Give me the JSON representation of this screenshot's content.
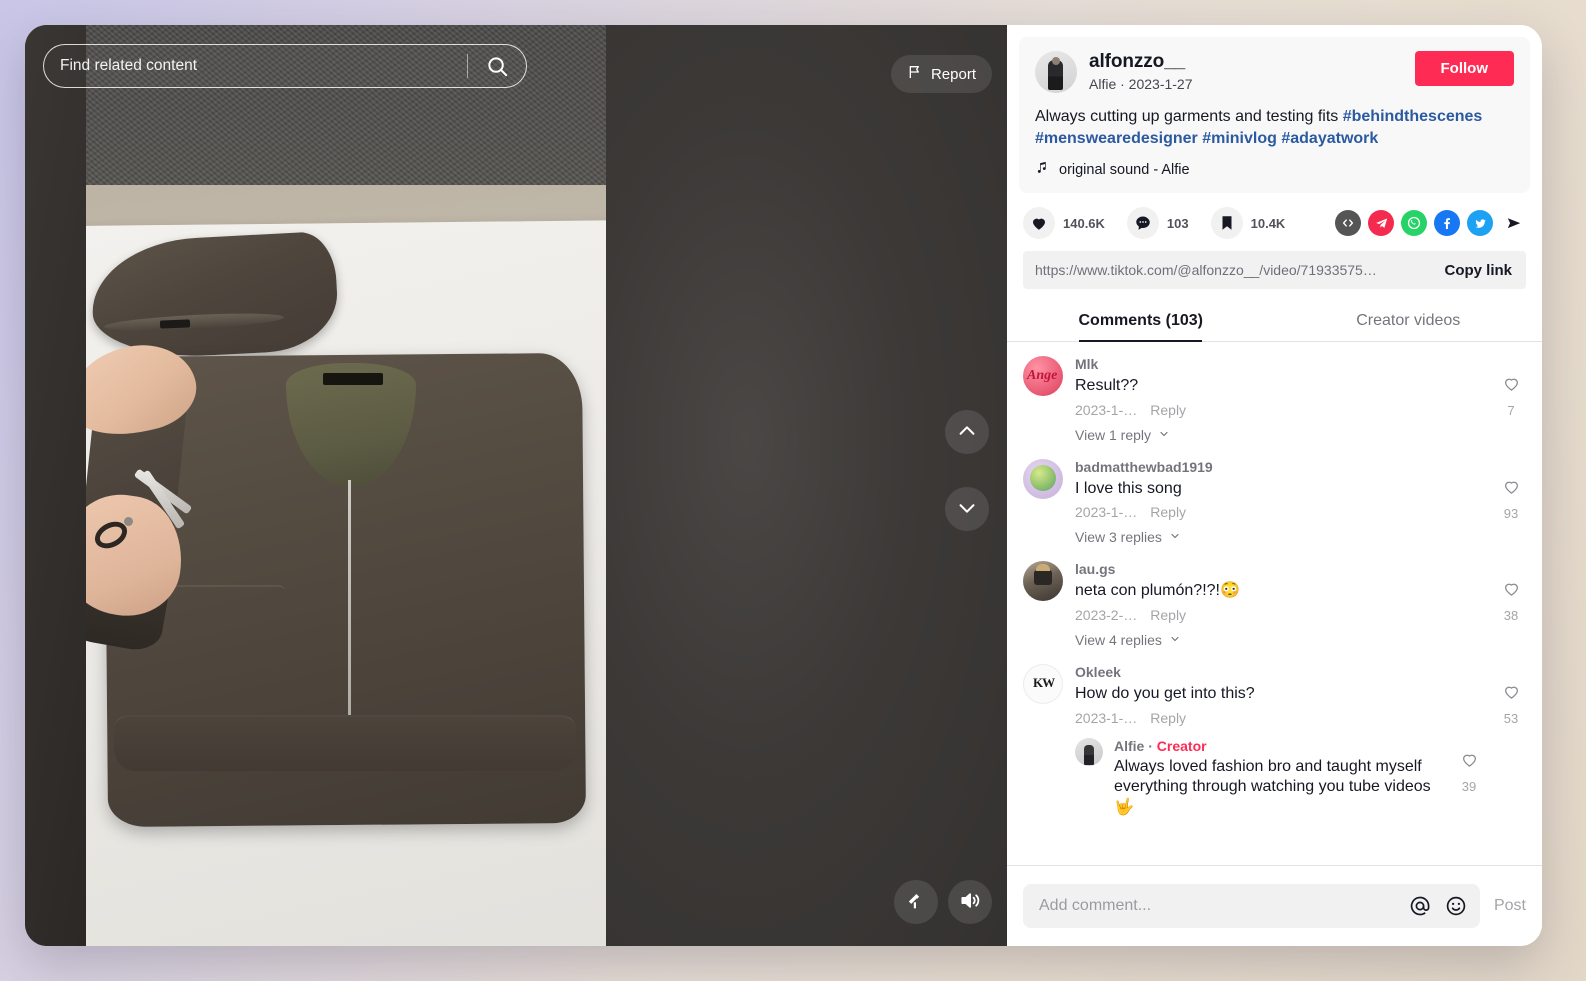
{
  "video": {
    "search_placeholder": "Find related content",
    "search_value": "",
    "search_icon": "search-icon",
    "report_label": "Report",
    "report_icon": "flag-icon",
    "nav_prev_icon": "chevron-up-icon",
    "nav_next_icon": "chevron-down-icon",
    "clear_mode_icon": "clear-display-icon",
    "volume_icon": "volume-on-icon"
  },
  "author": {
    "username": "alfonzzo__",
    "subline": "Alfie · 2023-1-27",
    "follow_label": "Follow",
    "avatar_name": "author-avatar",
    "caption_text": "Always cutting up garments and testing fits ",
    "hashtags": [
      "#behindthescenes",
      "#menswearedesigner",
      "#minivlog",
      "#adayatwork"
    ],
    "hashtag_1": "#behindthescenes",
    "hashtag_2": "#menswearedesigner",
    "hashtag_3": "#minivlog",
    "hashtag_4": "#adayatwork",
    "sound_icon": "music-note-icon",
    "sound_label": "original sound - Alfie"
  },
  "engagement": {
    "like_icon": "heart-filled-icon",
    "like_count": "140.6K",
    "comment_icon": "comment-bubble-icon",
    "comment_count": "103",
    "bookmark_icon": "bookmark-filled-icon",
    "bookmark_count": "10.4K",
    "share_targets": [
      {
        "name": "embed-icon",
        "label": "Embed",
        "color": "#555555"
      },
      {
        "name": "telegram-icon",
        "label": "Telegram",
        "color": "#f42a4e"
      },
      {
        "name": "whatsapp-icon",
        "label": "WhatsApp",
        "color": "#25d366"
      },
      {
        "name": "facebook-icon",
        "label": "Facebook",
        "color": "#1877f2"
      },
      {
        "name": "twitter-icon",
        "label": "Twitter",
        "color": "#1da1f2"
      },
      {
        "name": "share-arrow-icon",
        "label": "Share",
        "color": "#161823"
      }
    ]
  },
  "copy_link": {
    "url": "https://www.tiktok.com/@alfonzzo__/video/71933575…",
    "button_label": "Copy link"
  },
  "tabs": [
    {
      "label": "Comments (103)",
      "active": true
    },
    {
      "label": "Creator videos",
      "active": false
    }
  ],
  "tab_comments_label": "Comments (103)",
  "tab_creator_label": "Creator videos",
  "comments": [
    {
      "author": "Mlk",
      "text": "Result??",
      "date": "2023-1-…",
      "reply_label": "Reply",
      "like_count": "7",
      "view_replies": "View 1 reply",
      "avatar_color": "#f0798c"
    },
    {
      "author": "badmatthewbad1919",
      "text": "I love this song",
      "date": "2023-1-…",
      "reply_label": "Reply",
      "like_count": "93",
      "view_replies": "View 3 replies",
      "avatar_color": "#d9c8e6"
    },
    {
      "author": "lau.gs",
      "text": "neta con plumón?!?!😳",
      "date": "2023-2-…",
      "reply_label": "Reply",
      "like_count": "38",
      "view_replies": "View 4 replies",
      "avatar_color": "#5f5a55"
    },
    {
      "author": "Okleek",
      "text": "How do you get into this?",
      "date": "2023-1-…",
      "reply_label": "Reply",
      "like_count": "53",
      "view_replies": "",
      "avatar_color": "#ffffff",
      "reply": {
        "author": "Alfie",
        "badge": "Creator",
        "separator": " · ",
        "text": "Always loved fashion bro and taught myself everything through watching you tube videos 🤟",
        "like_count": "39"
      }
    }
  ],
  "add_comment": {
    "placeholder": "Add comment...",
    "value": "",
    "mention_icon": "at-mention-icon",
    "emoji_icon": "emoji-smiley-icon",
    "post_label": "Post"
  },
  "colors": {
    "brand_red": "#fe2c55",
    "text_primary": "#161823",
    "hashtag_blue": "#2b5aa0"
  }
}
